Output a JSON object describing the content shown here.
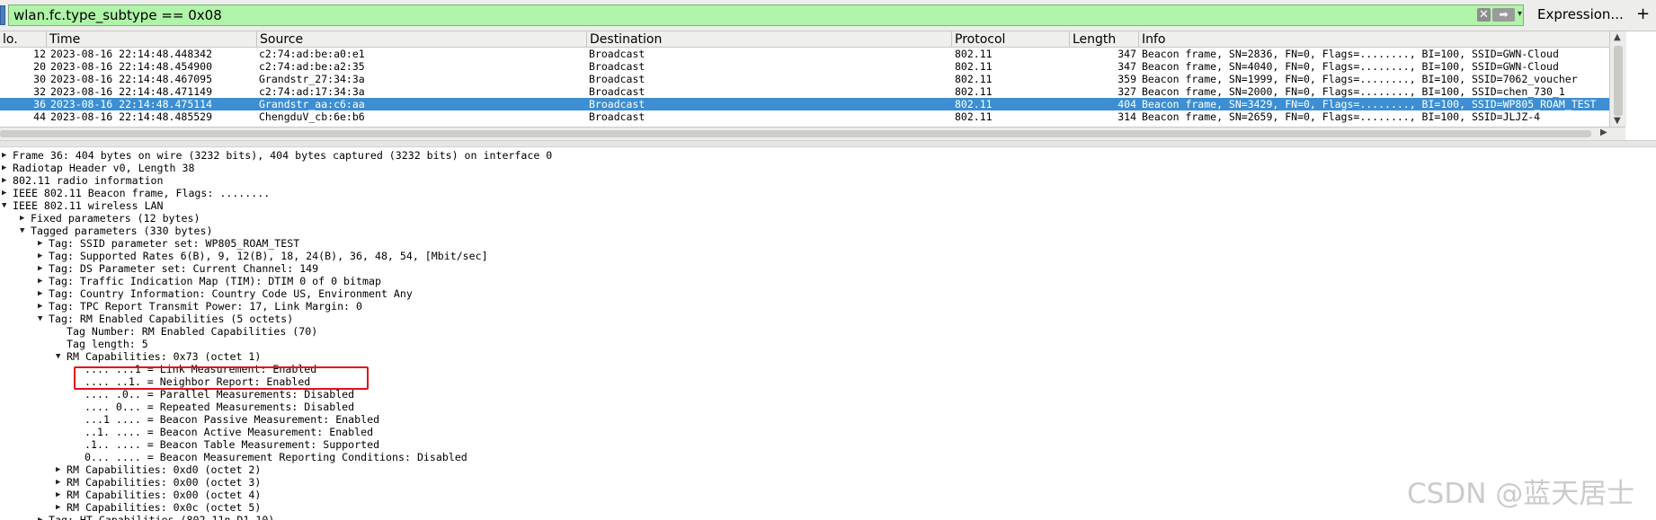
{
  "filter": {
    "value": "wlan.fc.type_subtype == 0x08",
    "clear_icon": "clear-icon",
    "apply_icon": "arrow-right-icon",
    "expression_label": "Expression...",
    "plus_label": "+"
  },
  "packet_list": {
    "columns": [
      "lo.",
      "Time",
      "Source",
      "Destination",
      "Protocol",
      "Length",
      "Info"
    ],
    "rows": [
      {
        "no": "12",
        "time": "2023-08-16 22:14:48.448342",
        "source": "c2:74:ad:be:a0:e1",
        "destination": "Broadcast",
        "protocol": "802.11",
        "length": "347",
        "info": "Beacon frame, SN=2836, FN=0, Flags=........, BI=100, SSID=GWN-Cloud",
        "selected": false
      },
      {
        "no": "20",
        "time": "2023-08-16 22:14:48.454900",
        "source": "c2:74:ad:be:a2:35",
        "destination": "Broadcast",
        "protocol": "802.11",
        "length": "347",
        "info": "Beacon frame, SN=4040, FN=0, Flags=........, BI=100, SSID=GWN-Cloud",
        "selected": false
      },
      {
        "no": "30",
        "time": "2023-08-16 22:14:48.467095",
        "source": "Grandstr_27:34:3a",
        "destination": "Broadcast",
        "protocol": "802.11",
        "length": "359",
        "info": "Beacon frame, SN=1999, FN=0, Flags=........, BI=100, SSID=7062_voucher",
        "selected": false
      },
      {
        "no": "32",
        "time": "2023-08-16 22:14:48.471149",
        "source": "c2:74:ad:17:34:3a",
        "destination": "Broadcast",
        "protocol": "802.11",
        "length": "327",
        "info": "Beacon frame, SN=2000, FN=0, Flags=........, BI=100, SSID=chen_730_1",
        "selected": false
      },
      {
        "no": "36",
        "time": "2023-08-16 22:14:48.475114",
        "source": "Grandstr_aa:c6:aa",
        "destination": "Broadcast",
        "protocol": "802.11",
        "length": "404",
        "info": "Beacon frame, SN=3429, FN=0, Flags=........, BI=100, SSID=WP805_ROAM_TEST",
        "selected": true
      },
      {
        "no": "44",
        "time": "2023-08-16 22:14:48.485529",
        "source": "ChengduV_cb:6e:b6",
        "destination": "Broadcast",
        "protocol": "802.11",
        "length": "314",
        "info": "Beacon frame, SN=2659, FN=0, Flags=........, BI=100, SSID=JLJZ-4",
        "selected": false
      }
    ]
  },
  "details": {
    "lines": [
      {
        "indent": 0,
        "arrow": "right",
        "text": "Frame 36: 404 bytes on wire (3232 bits), 404 bytes captured (3232 bits) on interface 0"
      },
      {
        "indent": 0,
        "arrow": "right",
        "text": "Radiotap Header v0, Length 38"
      },
      {
        "indent": 0,
        "arrow": "right",
        "text": "802.11 radio information"
      },
      {
        "indent": 0,
        "arrow": "right",
        "text": "IEEE 802.11 Beacon frame, Flags: ........"
      },
      {
        "indent": 0,
        "arrow": "down",
        "text": "IEEE 802.11 wireless LAN"
      },
      {
        "indent": 1,
        "arrow": "right",
        "text": "Fixed parameters (12 bytes)"
      },
      {
        "indent": 1,
        "arrow": "down",
        "text": "Tagged parameters (330 bytes)"
      },
      {
        "indent": 2,
        "arrow": "right",
        "text": "Tag: SSID parameter set: WP805_ROAM_TEST"
      },
      {
        "indent": 2,
        "arrow": "right",
        "text": "Tag: Supported Rates 6(B), 9, 12(B), 18, 24(B), 36, 48, 54, [Mbit/sec]"
      },
      {
        "indent": 2,
        "arrow": "right",
        "text": "Tag: DS Parameter set: Current Channel: 149"
      },
      {
        "indent": 2,
        "arrow": "right",
        "text": "Tag: Traffic Indication Map (TIM): DTIM 0 of 0 bitmap"
      },
      {
        "indent": 2,
        "arrow": "right",
        "text": "Tag: Country Information: Country Code US, Environment Any"
      },
      {
        "indent": 2,
        "arrow": "right",
        "text": "Tag: TPC Report Transmit Power: 17, Link Margin: 0"
      },
      {
        "indent": 2,
        "arrow": "down",
        "text": "Tag: RM Enabled Capabilities (5 octets)"
      },
      {
        "indent": 3,
        "arrow": "none",
        "text": "Tag Number: RM Enabled Capabilities (70)"
      },
      {
        "indent": 3,
        "arrow": "none",
        "text": "Tag length: 5"
      },
      {
        "indent": 3,
        "arrow": "down",
        "text": "RM Capabilities: 0x73 (octet 1)"
      },
      {
        "indent": 4,
        "arrow": "none",
        "text": ".... ...1 = Link Measurement: Enabled"
      },
      {
        "indent": 4,
        "arrow": "none",
        "text": ".... ..1. = Neighbor Report: Enabled"
      },
      {
        "indent": 4,
        "arrow": "none",
        "text": ".... .0.. = Parallel Measurements: Disabled"
      },
      {
        "indent": 4,
        "arrow": "none",
        "text": ".... 0... = Repeated Measurements: Disabled"
      },
      {
        "indent": 4,
        "arrow": "none",
        "text": "...1 .... = Beacon Passive Measurement: Enabled"
      },
      {
        "indent": 4,
        "arrow": "none",
        "text": "..1. .... = Beacon Active Measurement: Enabled"
      },
      {
        "indent": 4,
        "arrow": "none",
        "text": ".1.. .... = Beacon Table Measurement: Supported"
      },
      {
        "indent": 4,
        "arrow": "none",
        "text": "0... .... = Beacon Measurement Reporting Conditions: Disabled"
      },
      {
        "indent": 3,
        "arrow": "right",
        "text": "RM Capabilities: 0xd0 (octet 2)"
      },
      {
        "indent": 3,
        "arrow": "right",
        "text": "RM Capabilities: 0x00 (octet 3)"
      },
      {
        "indent": 3,
        "arrow": "right",
        "text": "RM Capabilities: 0x00 (octet 4)"
      },
      {
        "indent": 3,
        "arrow": "right",
        "text": "RM Capabilities: 0x0c (octet 5)"
      },
      {
        "indent": 2,
        "arrow": "right",
        "text": "Tag: HT Capabilities (802.11n D1.10)"
      }
    ]
  },
  "watermark": "CSDN @蓝天居士",
  "colors": {
    "filter_bg": "#aff4a8",
    "selected_row": "#3d8ed2",
    "highlight_box": "#e1101c"
  }
}
